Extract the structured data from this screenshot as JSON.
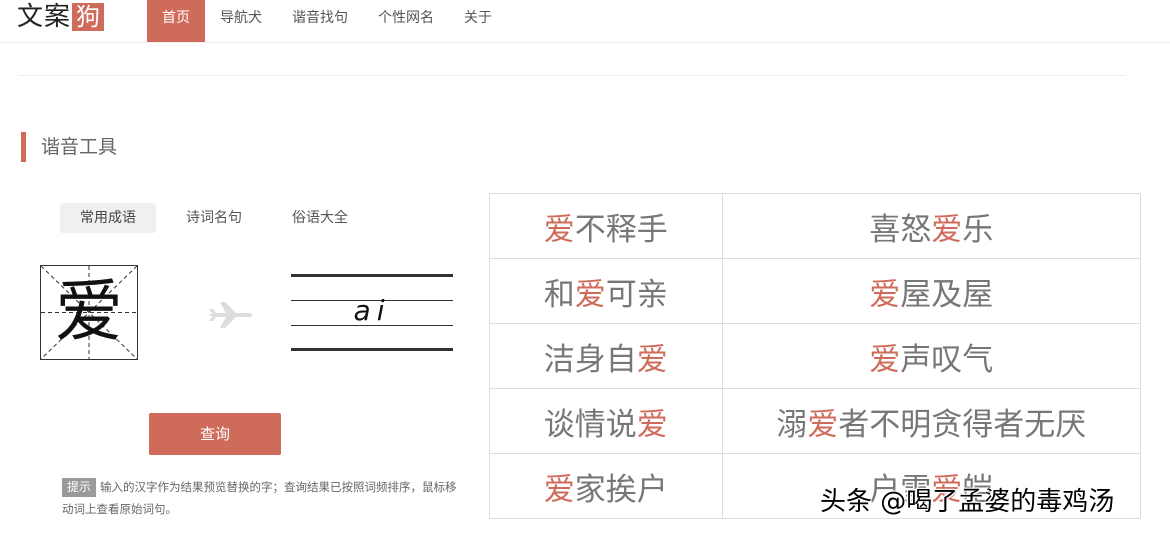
{
  "header": {
    "logo": {
      "text": "文案",
      "box": "狗"
    },
    "nav": [
      {
        "label": "首页",
        "active": true
      },
      {
        "label": "导航犬",
        "active": false
      },
      {
        "label": "谐音找句",
        "active": false
      },
      {
        "label": "个性网名",
        "active": false
      },
      {
        "label": "关于",
        "active": false
      }
    ]
  },
  "section": {
    "title": "谐音工具"
  },
  "tabs": [
    {
      "label": "常用成语",
      "active": true
    },
    {
      "label": "诗词名句",
      "active": false
    },
    {
      "label": "俗语大全",
      "active": false
    }
  ],
  "input": {
    "character": "爱",
    "pinyin": "ai"
  },
  "query_button": {
    "label": "查询"
  },
  "hint": {
    "badge": "提示",
    "text": "输入的汉字作为结果预览替换的字；查询结果已按照词频排序，鼠标移动词上查看原始词句。"
  },
  "results": [
    [
      {
        "parts": [
          "",
          "爱",
          "不释手"
        ]
      },
      {
        "parts": [
          "喜怒",
          "爱",
          "乐"
        ]
      }
    ],
    [
      {
        "parts": [
          "和",
          "爱",
          "可亲"
        ]
      },
      {
        "parts": [
          "",
          "爱",
          "屋及屋"
        ]
      }
    ],
    [
      {
        "parts": [
          "洁身自",
          "爱",
          ""
        ]
      },
      {
        "parts": [
          "",
          "爱",
          "声叹气"
        ]
      }
    ],
    [
      {
        "parts": [
          "谈情说",
          "爱",
          ""
        ]
      },
      {
        "parts": [
          "溺",
          "爱",
          "者不明贪得者无厌"
        ]
      }
    ],
    [
      {
        "parts": [
          "",
          "爱",
          "家挨户"
        ]
      },
      {
        "parts": [
          "户雪",
          "爱",
          "皑"
        ]
      }
    ]
  ],
  "colors": {
    "accent": "#cf6b5a",
    "text": "#777777",
    "border": "#dddddd"
  },
  "watermark": {
    "text": "头条 @喝了孟婆的毒鸡汤"
  }
}
